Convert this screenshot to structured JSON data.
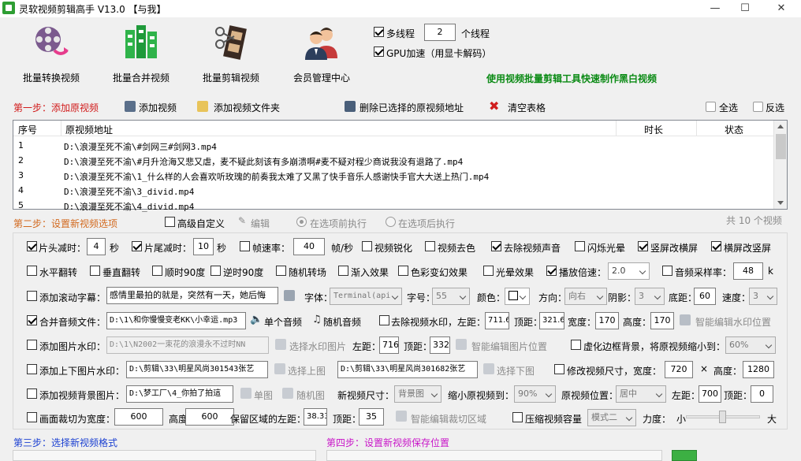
{
  "title": "灵软视频剪辑高手 V13.0  【与我】",
  "toolbar": {
    "batch_convert": "批量转换视频",
    "batch_merge": "批量合并视频",
    "batch_cut": "批量剪辑视频",
    "member_center": "会员管理中心"
  },
  "threads": {
    "multi_label": "多线程",
    "count": "2",
    "unit": "个线程",
    "gpu_label": "GPU加速（用显卡解码）"
  },
  "promo": "使用视频批量剪辑工具快速制作黑白视频",
  "step1": {
    "title": "第一步：添加原视频",
    "add_video": "添加视频",
    "add_folder": "添加视频文件夹",
    "delete_selected": "删除已选择的原视频地址",
    "clear_table": "清空表格",
    "select_all": "全选",
    "invert": "反选"
  },
  "table": {
    "headers": [
      "序号",
      "原视频地址",
      "时长",
      "状态"
    ],
    "rows": [
      {
        "n": "1",
        "path": "D:\\浪漫至死不渝\\#剑网三#剑网3.mp4"
      },
      {
        "n": "2",
        "path": "D:\\浪漫至死不渝\\#月升沧海又悲又虐，麦不疑此刻该有多崩溃啊#麦不疑对程少商说我没有退路了.mp4"
      },
      {
        "n": "3",
        "path": "D:\\浪漫至死不渝\\1_什么样的人会喜欢听玫瑰的前奏我太难了又黑了快手音乐人感谢快手官大大送上热门.mp4"
      },
      {
        "n": "4",
        "path": "D:\\浪漫至死不渝\\3_divid.mp4"
      },
      {
        "n": "5",
        "path": "D:\\浪漫至死不渝\\4_divid.mp4"
      }
    ]
  },
  "step2": {
    "title": "第二步：设置新视频选项",
    "advanced": "高级自定义",
    "edit": "编辑",
    "before": "在选项前执行",
    "after": "在选项后执行",
    "total": "共 10 个视频"
  },
  "opts": {
    "head_cut": "片头减时：",
    "head_val": "4",
    "sec": "秒",
    "tail_cut": "片尾减时：",
    "tail_val": "10",
    "sec2": "秒",
    "fps": "帧速率：",
    "fps_val": "40",
    "fps_unit": "帧/秒",
    "sharpen": "视频锐化",
    "decolor": "视频去色",
    "remove_audio": "去除视频声音",
    "flash": "闪烁光晕",
    "v2h": "竖屏改横屏",
    "h2v": "横屏改竖屏",
    "hflip": "水平翻转",
    "vflip": "垂直翻转",
    "cw90": "顺时90度",
    "ccw90": "逆时90度",
    "rand_trans": "随机转场",
    "fade_in": "渐入效果",
    "color_change": "色彩变幻效果",
    "light": "光晕效果",
    "speed": "播放倍速：",
    "speed_val": "2.0",
    "sample": "音频采样率：",
    "sample_val": "48",
    "sample_unit": "k",
    "scroll_sub": "添加滚动字幕：",
    "scroll_text": "感情里最拍的就是，突然有一天，她后悔",
    "font_lbl": "字体：",
    "font_val": "Terminal(api",
    "size_lbl": "字号：",
    "size_val": "55",
    "color_lbl": "颜色：",
    "dir_lbl": "方向：",
    "dir_val": "向右",
    "shadow_lbl": "阴影：",
    "shadow_val": "3",
    "bottom_lbl": "底距：",
    "bottom_val": "60",
    "speed2_lbl": "速度：",
    "speed2_val": "3",
    "merge_audio": "合并音频文件：",
    "merge_path": "D:\\1\\和你慢慢变老KK\\小幸运.mp3",
    "single_audio": "单个音频",
    "rand_audio": "随机音频",
    "remove_wm": "去除视频水印，左距：",
    "wm_left": "711.6",
    "top_lbl": "顶距：",
    "wm_top": "321.6",
    "width_lbl": "宽度：",
    "wm_w": "170",
    "height_lbl": "高度：",
    "wm_h": "170",
    "smart_wm": "智能编辑水印位置",
    "img_wm": "添加图片水印：",
    "img_wm_path": "D:\\1\\N2002一束花的浪漫永不过时NN",
    "select_wm_img": "选择水印图片",
    "left_lbl": "左距：",
    "img_left": "716",
    "img_top_lbl": "顶距：",
    "img_top": "332",
    "smart_img": "智能编辑图片位置",
    "blur_border": "虚化边框背景，将原视频缩小到：",
    "blur_val": "60%",
    "tb_wm": "添加上下图片水印：",
    "top_img": "D:\\剪辑\\33\\明星风尚301543张艺",
    "select_top": "选择上图",
    "bottom_img": "D:\\剪辑\\33\\明星风尚301682张艺",
    "select_bottom": "选择下图",
    "resize": "修改视频尺寸，宽度：",
    "resize_w": "720",
    "times": "×",
    "height2_lbl": "高度：",
    "resize_h": "1280",
    "bg_img": "添加视频背景图片：",
    "bg_path": "D:\\梦工厂\\4_你拍了拍這",
    "single_img": "单图",
    "rand_img": "随机图",
    "new_size_lbl": "新视频尺寸：",
    "new_size_val": "背景图",
    "shrink_lbl": "缩小原视频到：",
    "shrink_val": "90%",
    "pos_lbl": "原视频位置：",
    "pos_val": "居中",
    "left2_lbl": "左距：",
    "left2_val": "700",
    "top2_lbl": "顶距：",
    "top2_val": "0",
    "crop": "画面裁切为宽度：",
    "crop_w": "600",
    "crop_h_lbl": "高度：",
    "crop_h": "600",
    "keep_left": "保留区域的左距：",
    "keep_left_val": "38.33",
    "keep_top_lbl": "顶距：",
    "keep_top_val": "35",
    "smart_crop": "智能编辑裁切区域",
    "compress": "压缩视频容量",
    "mode_val": "模式二",
    "strength": "力度：",
    "small": "小",
    "big": "大"
  },
  "step3": {
    "title": "第三步：选择新视频格式"
  },
  "step4": {
    "title": "第四步：设置新视频保存位置"
  }
}
